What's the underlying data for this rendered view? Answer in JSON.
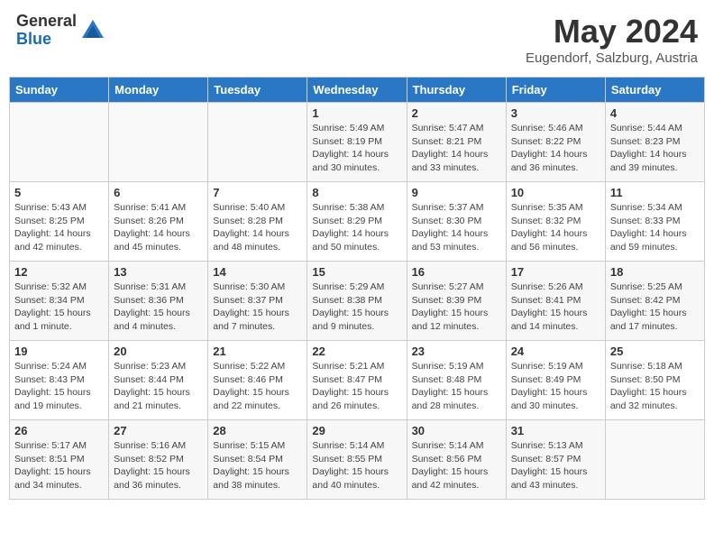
{
  "header": {
    "logo_general": "General",
    "logo_blue": "Blue",
    "month_year": "May 2024",
    "location": "Eugendorf, Salzburg, Austria"
  },
  "calendar": {
    "days_of_week": [
      "Sunday",
      "Monday",
      "Tuesday",
      "Wednesday",
      "Thursday",
      "Friday",
      "Saturday"
    ],
    "weeks": [
      [
        {
          "day": "",
          "info": ""
        },
        {
          "day": "",
          "info": ""
        },
        {
          "day": "",
          "info": ""
        },
        {
          "day": "1",
          "info": "Sunrise: 5:49 AM\nSunset: 8:19 PM\nDaylight: 14 hours\nand 30 minutes."
        },
        {
          "day": "2",
          "info": "Sunrise: 5:47 AM\nSunset: 8:21 PM\nDaylight: 14 hours\nand 33 minutes."
        },
        {
          "day": "3",
          "info": "Sunrise: 5:46 AM\nSunset: 8:22 PM\nDaylight: 14 hours\nand 36 minutes."
        },
        {
          "day": "4",
          "info": "Sunrise: 5:44 AM\nSunset: 8:23 PM\nDaylight: 14 hours\nand 39 minutes."
        }
      ],
      [
        {
          "day": "5",
          "info": "Sunrise: 5:43 AM\nSunset: 8:25 PM\nDaylight: 14 hours\nand 42 minutes."
        },
        {
          "day": "6",
          "info": "Sunrise: 5:41 AM\nSunset: 8:26 PM\nDaylight: 14 hours\nand 45 minutes."
        },
        {
          "day": "7",
          "info": "Sunrise: 5:40 AM\nSunset: 8:28 PM\nDaylight: 14 hours\nand 48 minutes."
        },
        {
          "day": "8",
          "info": "Sunrise: 5:38 AM\nSunset: 8:29 PM\nDaylight: 14 hours\nand 50 minutes."
        },
        {
          "day": "9",
          "info": "Sunrise: 5:37 AM\nSunset: 8:30 PM\nDaylight: 14 hours\nand 53 minutes."
        },
        {
          "day": "10",
          "info": "Sunrise: 5:35 AM\nSunset: 8:32 PM\nDaylight: 14 hours\nand 56 minutes."
        },
        {
          "day": "11",
          "info": "Sunrise: 5:34 AM\nSunset: 8:33 PM\nDaylight: 14 hours\nand 59 minutes."
        }
      ],
      [
        {
          "day": "12",
          "info": "Sunrise: 5:32 AM\nSunset: 8:34 PM\nDaylight: 15 hours\nand 1 minute."
        },
        {
          "day": "13",
          "info": "Sunrise: 5:31 AM\nSunset: 8:36 PM\nDaylight: 15 hours\nand 4 minutes."
        },
        {
          "day": "14",
          "info": "Sunrise: 5:30 AM\nSunset: 8:37 PM\nDaylight: 15 hours\nand 7 minutes."
        },
        {
          "day": "15",
          "info": "Sunrise: 5:29 AM\nSunset: 8:38 PM\nDaylight: 15 hours\nand 9 minutes."
        },
        {
          "day": "16",
          "info": "Sunrise: 5:27 AM\nSunset: 8:39 PM\nDaylight: 15 hours\nand 12 minutes."
        },
        {
          "day": "17",
          "info": "Sunrise: 5:26 AM\nSunset: 8:41 PM\nDaylight: 15 hours\nand 14 minutes."
        },
        {
          "day": "18",
          "info": "Sunrise: 5:25 AM\nSunset: 8:42 PM\nDaylight: 15 hours\nand 17 minutes."
        }
      ],
      [
        {
          "day": "19",
          "info": "Sunrise: 5:24 AM\nSunset: 8:43 PM\nDaylight: 15 hours\nand 19 minutes."
        },
        {
          "day": "20",
          "info": "Sunrise: 5:23 AM\nSunset: 8:44 PM\nDaylight: 15 hours\nand 21 minutes."
        },
        {
          "day": "21",
          "info": "Sunrise: 5:22 AM\nSunset: 8:46 PM\nDaylight: 15 hours\nand 22 minutes."
        },
        {
          "day": "22",
          "info": "Sunrise: 5:21 AM\nSunset: 8:47 PM\nDaylight: 15 hours\nand 26 minutes."
        },
        {
          "day": "23",
          "info": "Sunrise: 5:19 AM\nSunset: 8:48 PM\nDaylight: 15 hours\nand 28 minutes."
        },
        {
          "day": "24",
          "info": "Sunrise: 5:19 AM\nSunset: 8:49 PM\nDaylight: 15 hours\nand 30 minutes."
        },
        {
          "day": "25",
          "info": "Sunrise: 5:18 AM\nSunset: 8:50 PM\nDaylight: 15 hours\nand 32 minutes."
        }
      ],
      [
        {
          "day": "26",
          "info": "Sunrise: 5:17 AM\nSunset: 8:51 PM\nDaylight: 15 hours\nand 34 minutes."
        },
        {
          "day": "27",
          "info": "Sunrise: 5:16 AM\nSunset: 8:52 PM\nDaylight: 15 hours\nand 36 minutes."
        },
        {
          "day": "28",
          "info": "Sunrise: 5:15 AM\nSunset: 8:54 PM\nDaylight: 15 hours\nand 38 minutes."
        },
        {
          "day": "29",
          "info": "Sunrise: 5:14 AM\nSunset: 8:55 PM\nDaylight: 15 hours\nand 40 minutes."
        },
        {
          "day": "30",
          "info": "Sunrise: 5:14 AM\nSunset: 8:56 PM\nDaylight: 15 hours\nand 42 minutes."
        },
        {
          "day": "31",
          "info": "Sunrise: 5:13 AM\nSunset: 8:57 PM\nDaylight: 15 hours\nand 43 minutes."
        },
        {
          "day": "",
          "info": ""
        }
      ]
    ]
  }
}
